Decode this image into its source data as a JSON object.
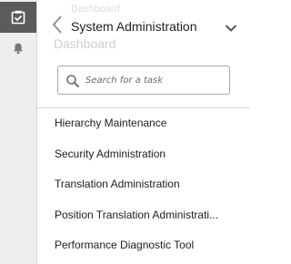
{
  "rail": {
    "items": [
      {
        "icon": "checklist-icon",
        "active": true
      },
      {
        "icon": "bell-icon",
        "active": false
      }
    ]
  },
  "panel": {
    "ghost_above": "Dashboard",
    "ghost_below": "Dashboard",
    "title": "System Administration",
    "search": {
      "placeholder": "Search for a task",
      "value": ""
    },
    "tasks": [
      "Hierarchy Maintenance",
      "Security Administration",
      "Translation Administration",
      "Position Translation Administrati...",
      "Performance Diagnostic Tool"
    ]
  },
  "colors": {
    "rail_bg": "#eeeeee",
    "active_bg": "#5b5b5b",
    "text": "#1d1d1d",
    "border": "#a9a9a9"
  }
}
